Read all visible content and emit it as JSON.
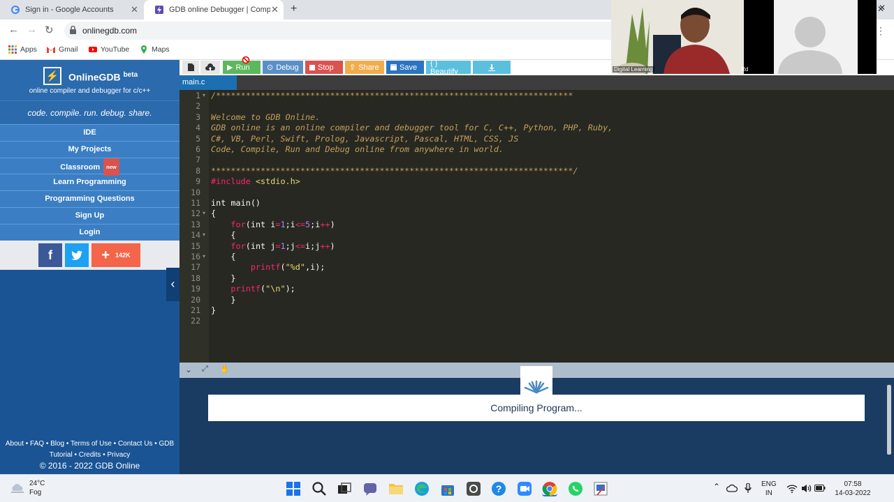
{
  "browser": {
    "tabs": [
      {
        "title": "Sign in - Google Accounts",
        "active": false
      },
      {
        "title": "GDB online Debugger | Compiler",
        "active": true
      }
    ],
    "url": "onlinegdb.com",
    "bookmarks": [
      "Apps",
      "Gmail",
      "YouTube",
      "Maps"
    ]
  },
  "sidebar": {
    "logo_name": "OnlineGDB",
    "logo_beta": "beta",
    "logo_sub": "online compiler and debugger for c/c++",
    "tagline": "code. compile. run. debug. share.",
    "menu": [
      {
        "label": "IDE"
      },
      {
        "label": "My Projects"
      },
      {
        "label": "Classroom",
        "badge": "new"
      },
      {
        "label": "Learn Programming"
      },
      {
        "label": "Programming Questions"
      },
      {
        "label": "Sign Up"
      },
      {
        "label": "Login"
      }
    ],
    "social_count": "142K",
    "footer_line1": "About • FAQ • Blog • Terms of Use • Contact Us • GDB",
    "footer_line2": "Tutorial • Credits • Privacy",
    "copyright": "© 2016 - 2022 GDB Online"
  },
  "ide": {
    "toolbar": {
      "run": "Run",
      "debug": "Debug",
      "stop": "Stop",
      "share": "Share",
      "save": "Save",
      "beautify": "{ } Beautify"
    },
    "file_tab": "main.c",
    "line_numbers": [
      "1",
      "2",
      "3",
      "4",
      "5",
      "6",
      "7",
      "8",
      "9",
      "10",
      "11",
      "12",
      "13",
      "14",
      "15",
      "16",
      "17",
      "18",
      "19",
      "20",
      "21",
      "22"
    ],
    "console_status": "Compiling Program..."
  },
  "webcam": {
    "left_label": "Digital Learning",
    "right_label": "Rd"
  },
  "taskbar": {
    "temp": "24°C",
    "weather": "Fog",
    "lang1": "ENG",
    "lang2": "IN",
    "time": "07:58",
    "date": "14-03-2022"
  },
  "colors": {
    "sidebar": "#1a5494",
    "editor_bg": "#272822",
    "run": "#5cb85c",
    "debug": "#5a8fc8",
    "stop": "#d9534f",
    "share": "#f0ad4e",
    "save": "#2b74c1",
    "beautify": "#5bc0de"
  }
}
